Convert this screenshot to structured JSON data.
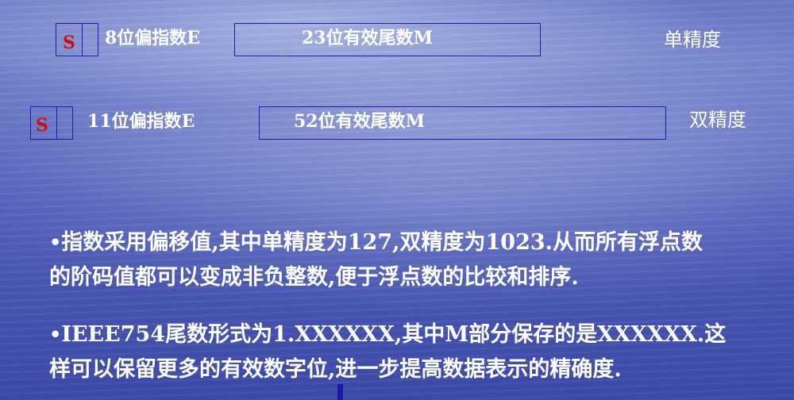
{
  "single": {
    "sign": "S",
    "exponent": "8位偏指数E",
    "mantissa": "23位有效尾数M",
    "precision": "单精度"
  },
  "double": {
    "sign": "S",
    "exponent": "11位偏指数E",
    "mantissa": "52位有效尾数M",
    "precision": "双精度"
  },
  "bullets": [
    {
      "bullet": "•",
      "line1": "指数采用偏移值,其中单精度为127,双精度为1023.从而所有浮点数",
      "line2": "的阶码值都可以变成非负整数,便于浮点数的比较和排序."
    },
    {
      "bullet": "•",
      "line1": "IEEE754尾数形式为1.XXXXXX,其中M部分保存的是XXXXXX.这",
      "line2": "样可以保留更多的有效数字位,进一步提高数据表示的精确度."
    }
  ],
  "colors": {
    "box_border": "#1e1ea8",
    "sign_text": "#c81010",
    "text": "#ffffff"
  }
}
